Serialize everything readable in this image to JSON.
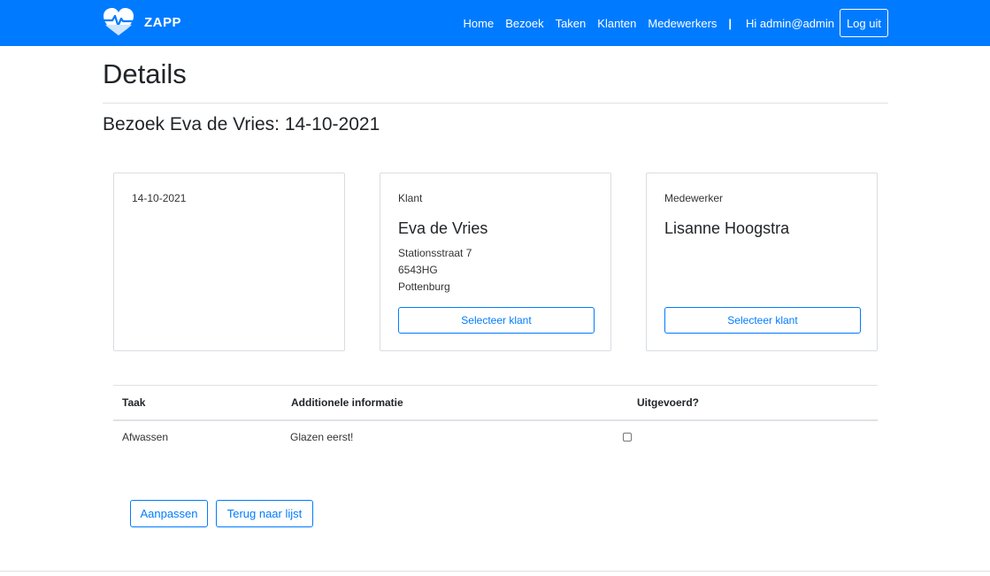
{
  "brand": {
    "name": "ZAPP"
  },
  "nav": {
    "links": [
      "Home",
      "Bezoek",
      "Taken",
      "Klanten",
      "Medewerkers"
    ],
    "separator": "|",
    "greeting": "Hi admin@admin",
    "logout": "Log uit"
  },
  "page": {
    "title": "Details",
    "subtitle": "Bezoek Eva de Vries: 14-10-2021"
  },
  "cards": {
    "date": "14-10-2021",
    "client": {
      "label": "Klant",
      "name": "Eva de Vries",
      "street": "Stationsstraat 7",
      "postcode": "6543HG",
      "city": "Pottenburg",
      "button": "Selecteer klant"
    },
    "employee": {
      "label": "Medewerker",
      "name": "Lisanne Hoogstra",
      "button": "Selecteer klant"
    }
  },
  "table": {
    "headers": [
      "Taak",
      "Additionele informatie",
      "Uitgevoerd?"
    ],
    "rows": [
      {
        "task": "Afwassen",
        "info": "Glazen eerst!",
        "done": false
      }
    ]
  },
  "actions": {
    "edit": "Aanpassen",
    "back": "Terug naar lijst"
  },
  "colors": {
    "primary": "#007bff",
    "border": "#dee2e6"
  },
  "icons": {
    "brand": "heart-pulse-icon"
  }
}
